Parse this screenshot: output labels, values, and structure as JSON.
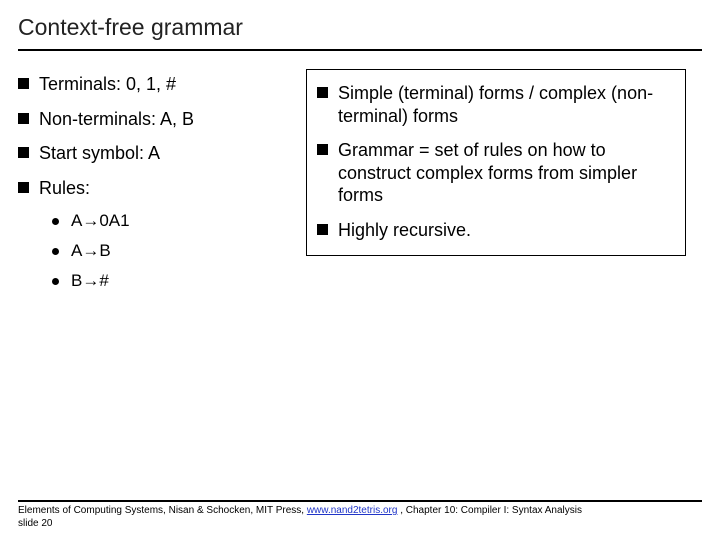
{
  "title": "Context-free grammar",
  "left": {
    "terminals": "Terminals: 0, 1, #",
    "nonterminals": "Non-terminals: A, B",
    "start": "Start symbol: A",
    "rules_label": "Rules:",
    "rules": {
      "r1": "A→0A1",
      "r2": "A→B",
      "r3": "B→#"
    }
  },
  "right": {
    "p1": "Simple (terminal) forms / complex (non-terminal) forms",
    "p2": "Grammar = set of rules on how to construct complex forms from simpler forms",
    "p3": "Highly recursive."
  },
  "footer": {
    "prefix": "Elements of Computing Systems, Nisan & Schocken, MIT Press, ",
    "link": "www.nand2tetris.org",
    "suffix": " , Chapter 10: Compiler I: Syntax Analysis",
    "slide": "slide 20"
  }
}
